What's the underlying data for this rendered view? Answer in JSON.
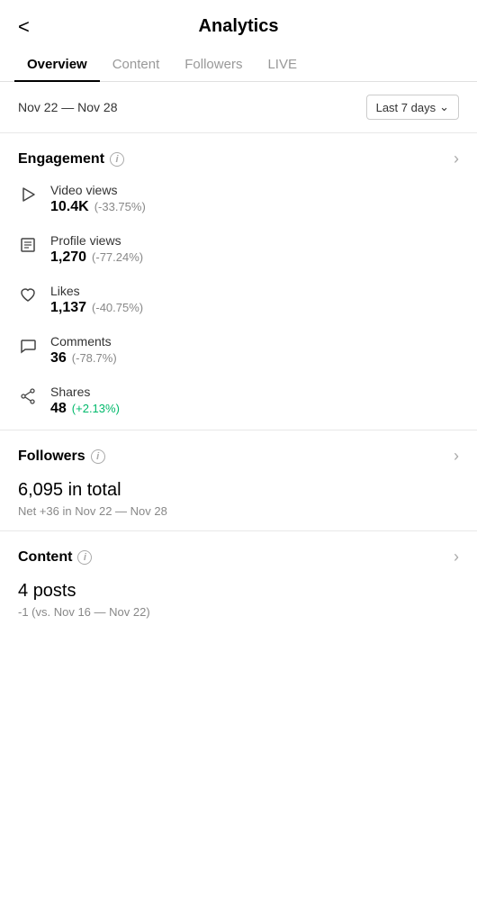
{
  "header": {
    "title": "Analytics",
    "back_label": "<"
  },
  "tabs": [
    {
      "label": "Overview",
      "active": true
    },
    {
      "label": "Content",
      "active": false
    },
    {
      "label": "Followers",
      "active": false
    },
    {
      "label": "LIVE",
      "active": false
    }
  ],
  "date_range": {
    "text": "Nov 22 — Nov 28",
    "selector_label": "Last 7 days"
  },
  "engagement": {
    "section_title": "Engagement",
    "metrics": [
      {
        "label": "Video views",
        "value": "10.4K",
        "change": "(-33.75%)",
        "positive": false,
        "icon": "play-icon"
      },
      {
        "label": "Profile views",
        "value": "1,270",
        "change": "(-77.24%)",
        "positive": false,
        "icon": "profile-icon"
      },
      {
        "label": "Likes",
        "value": "1,137",
        "change": "(-40.75%)",
        "positive": false,
        "icon": "heart-icon"
      },
      {
        "label": "Comments",
        "value": "36",
        "change": "(-78.7%)",
        "positive": false,
        "icon": "comment-icon"
      },
      {
        "label": "Shares",
        "value": "48",
        "change": "(+2.13%)",
        "positive": true,
        "icon": "share-icon"
      }
    ]
  },
  "followers": {
    "section_title": "Followers",
    "total_value": "6,095",
    "total_label": "in total",
    "net_text": "Net +36 in Nov 22 — Nov 28"
  },
  "content": {
    "section_title": "Content",
    "posts_value": "4",
    "posts_label": "posts",
    "compare_text": "-1 (vs. Nov 16 — Nov 22)"
  }
}
